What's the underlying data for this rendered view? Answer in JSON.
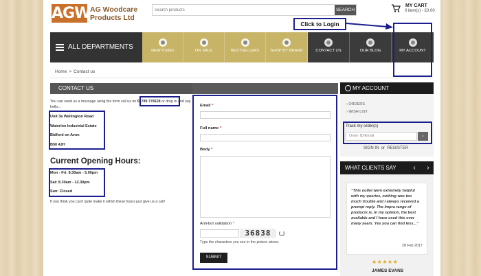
{
  "header": {
    "logo_mark": "AGW",
    "logo_text": "AG Woodcare Products Ltd",
    "search_placeholder": "Search products",
    "search_button": "SEARCH",
    "cart_title": "MY CART",
    "cart_items": "0 item(s) - £0.00"
  },
  "annotation": {
    "callout": "Click to Login"
  },
  "nav": {
    "all_departments": "ALL DEPARTMENTS",
    "items": [
      {
        "label": "NEW ITEMS"
      },
      {
        "label": "ON SALE"
      },
      {
        "label": "BESTSELLERS"
      },
      {
        "label": "SHOP BY BRAND"
      },
      {
        "label": "CONTACT US"
      },
      {
        "label": "OUR BLOG"
      },
      {
        "label": "MY ACCOUNT"
      }
    ]
  },
  "breadcrumb": {
    "home": "Home",
    "sep": ">",
    "current": "Contact us"
  },
  "contact": {
    "heading": "CONTACT US",
    "intro_before": "You can send us a message using the form call us on",
    "phone": "01789 778628",
    "intro_after": "or drop in and say hello...",
    "address": [
      "Unit 3a Wellington Road",
      "Waterloo Industrial Estate",
      "Bidford on Avon",
      "B50 4JH"
    ],
    "hours_title": "Current Opening Hours:",
    "hours": [
      "Mon - Fri: 8.30am - 5.00pm",
      "Sat: 8.30am - 12.30pm",
      "Sun: Closed"
    ],
    "hours_note": "If you think you can't quite make it within these hours just give us a call!"
  },
  "form": {
    "email_label": "Email",
    "name_label": "Full name",
    "body_label": "Body",
    "required_mark": "*",
    "antibot_label": "Anti-bot validation",
    "captcha_text": "36838",
    "captcha_help": "Type the characters you see in the picture above.",
    "submit": "SUBMIT"
  },
  "sidebar": {
    "account_title": "MY ACCOUNT",
    "links": [
      "ORDERS",
      "WISH LIST"
    ],
    "track_label": "Track my order(s)",
    "track_placeholder": "Order ID/Email",
    "sign_in": "SIGN IN",
    "or": "or",
    "register": "REGISTER",
    "clients_title": "WHAT CLIENTS SAY",
    "testimonial": "\"This outlet were extremely helpful with my queries, nothing was too much trouble and I always received a prompt reply. The Impra range of products is, in my opinion, the best available and I have used this over many years. Yes you can find less...\"",
    "testimonial_date": "28 Feb 2017",
    "stars": "★★★★★",
    "rating": 5,
    "reviewer": "JAMES EVANS"
  },
  "colors": {
    "gold_nav": "#c7b466",
    "highlight": "#1b1e8c",
    "logo": "#c9702a"
  }
}
